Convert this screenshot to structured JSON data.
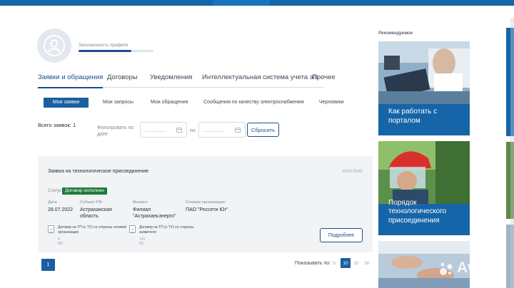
{
  "profile": {
    "completeness_label": "Заполненность профиля",
    "completeness_fraction": 0.7
  },
  "main_tabs": [
    {
      "label": "Заявки и обращения"
    },
    {
      "label": "Договоры"
    },
    {
      "label": "Уведомления"
    },
    {
      "label": "Интеллектуальная система учета э/э"
    },
    {
      "label": "Прочее"
    }
  ],
  "sub_tabs": [
    {
      "label": "Мои заявки"
    },
    {
      "label": "Мои запросы"
    },
    {
      "label": "Мои обращения"
    },
    {
      "label": "Сообщения по качеству электроснабжения"
    },
    {
      "label": "Черновики"
    }
  ],
  "filter": {
    "total": "Всего заявок: 1",
    "filter_label": "Фильтровать по дате",
    "date_from_placeholder": "__.__.____",
    "po": "по",
    "date_to_placeholder": "__.__.____",
    "reset": "Сбросить"
  },
  "application": {
    "title": "Заявка на технологическое присоединение",
    "number": "#5457845",
    "status_label": "Статус:",
    "status": "Договор исполнен",
    "date_label": "Дата:",
    "date": "28.07.2022",
    "subject_label": "Субъект РФ:",
    "subject": "Астраханская область",
    "branch_label": "Филиал:",
    "branch": "Филиал \"Астраханьэнерго\"",
    "network_label": "Сетевая организация:",
    "network": "ПАО \"Россети Юг\"",
    "documents": [
      {
        "name": "Договор на ТП (с ТУ) со стороны сетевой организации",
        "size": "4 Мб"
      },
      {
        "name": "Договор на ТП (с ТУ) со стороны заявителя",
        "size": "145 Кб"
      }
    ],
    "more": "Подробнее"
  },
  "pagination": {
    "current_page": "1",
    "show_label": "Показывать по:",
    "sizes": [
      "5",
      "10",
      "15",
      "30"
    ],
    "active_size": "10"
  },
  "recommended": {
    "title": "Рекомендуемое",
    "cards": [
      {
        "text": "Как работать с порталом"
      },
      {
        "text": "Порядок технологического присоединения"
      }
    ]
  },
  "watermark": "Avito",
  "colors": {
    "brand": "#1565a8",
    "accent": "#1a4f8b",
    "status_green": "#1f7a3a"
  }
}
